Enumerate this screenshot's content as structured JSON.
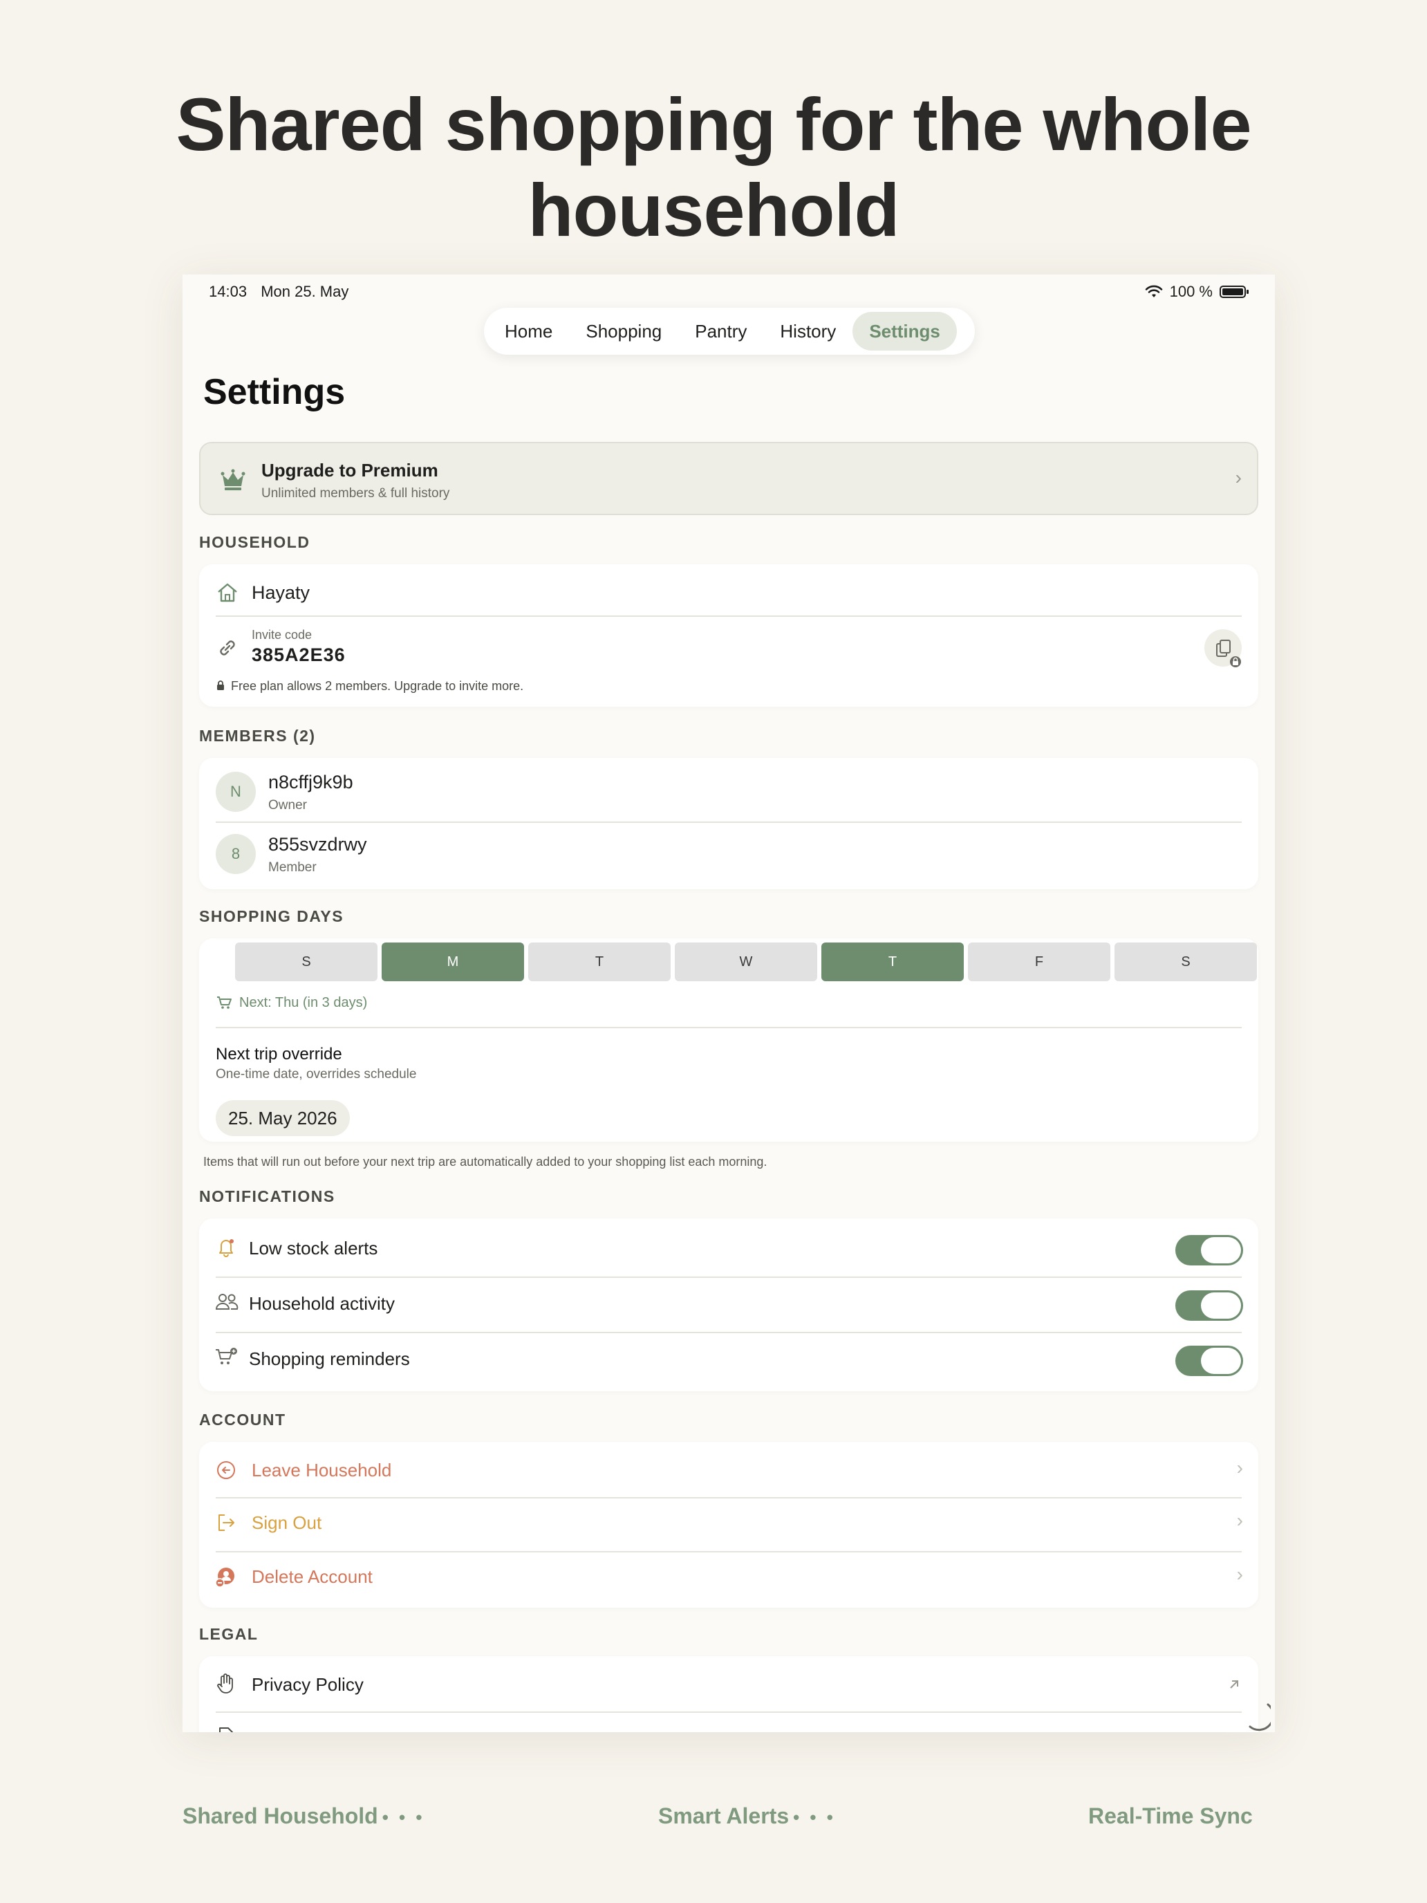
{
  "headline": "Shared shopping for the whole household",
  "status": {
    "time": "14:03",
    "date": "Mon 25. May",
    "battery": "100 %"
  },
  "tabs": [
    {
      "label": "Home"
    },
    {
      "label": "Shopping"
    },
    {
      "label": "Pantry"
    },
    {
      "label": "History"
    },
    {
      "label": "Settings",
      "active": true
    }
  ],
  "page_title": "Settings",
  "premium": {
    "title": "Upgrade to Premium",
    "subtitle": "Unlimited members & full history",
    "icon": "crown-icon"
  },
  "household": {
    "label": "HOUSEHOLD",
    "name": "Hayaty",
    "invite_label": "Invite code",
    "invite_code": "385A2E36",
    "plan_note": "Free plan allows 2 members. Upgrade to invite more."
  },
  "members": {
    "label": "MEMBERS (2)",
    "items": [
      {
        "initial": "N",
        "name": "n8cffj9k9b",
        "role": "Owner"
      },
      {
        "initial": "8",
        "name": "855svzdrwy",
        "role": "Member"
      }
    ]
  },
  "shopping_days": {
    "label": "SHOPPING DAYS",
    "days": [
      {
        "letter": "S",
        "selected": false
      },
      {
        "letter": "M",
        "selected": true
      },
      {
        "letter": "T",
        "selected": false
      },
      {
        "letter": "W",
        "selected": false
      },
      {
        "letter": "T",
        "selected": true
      },
      {
        "letter": "F",
        "selected": false
      },
      {
        "letter": "S",
        "selected": false
      }
    ],
    "next": "Next: Thu (in 3 days)",
    "override_title": "Next trip override",
    "override_sub": "One-time date, overrides schedule",
    "override_date": "25. May 2026",
    "footnote": "Items that will run out before your next trip are automatically added to your shopping list each morning."
  },
  "notifications": {
    "label": "NOTIFICATIONS",
    "items": [
      {
        "label": "Low stock alerts",
        "enabled": true,
        "icon": "bell-icon"
      },
      {
        "label": "Household activity",
        "enabled": true,
        "icon": "people-icon"
      },
      {
        "label": "Shopping reminders",
        "enabled": true,
        "icon": "cart-plus-icon"
      }
    ]
  },
  "account": {
    "label": "ACCOUNT",
    "items": [
      {
        "label": "Leave Household",
        "color": "#d4775a"
      },
      {
        "label": "Sign Out",
        "color": "#d9a13f"
      },
      {
        "label": "Delete Account",
        "color": "#d4775a"
      }
    ]
  },
  "legal": {
    "label": "LEGAL",
    "items": [
      {
        "label": "Privacy Policy"
      }
    ]
  },
  "colors": {
    "accent": "#6d8d6e",
    "background": "#f7f4ed",
    "danger": "#d4775a",
    "warning": "#d9a13f"
  },
  "footer": [
    {
      "label": "Shared Household",
      "dots": "• • •"
    },
    {
      "label": "Smart Alerts",
      "dots": "• • •"
    },
    {
      "label": "Real-Time Sync"
    }
  ]
}
